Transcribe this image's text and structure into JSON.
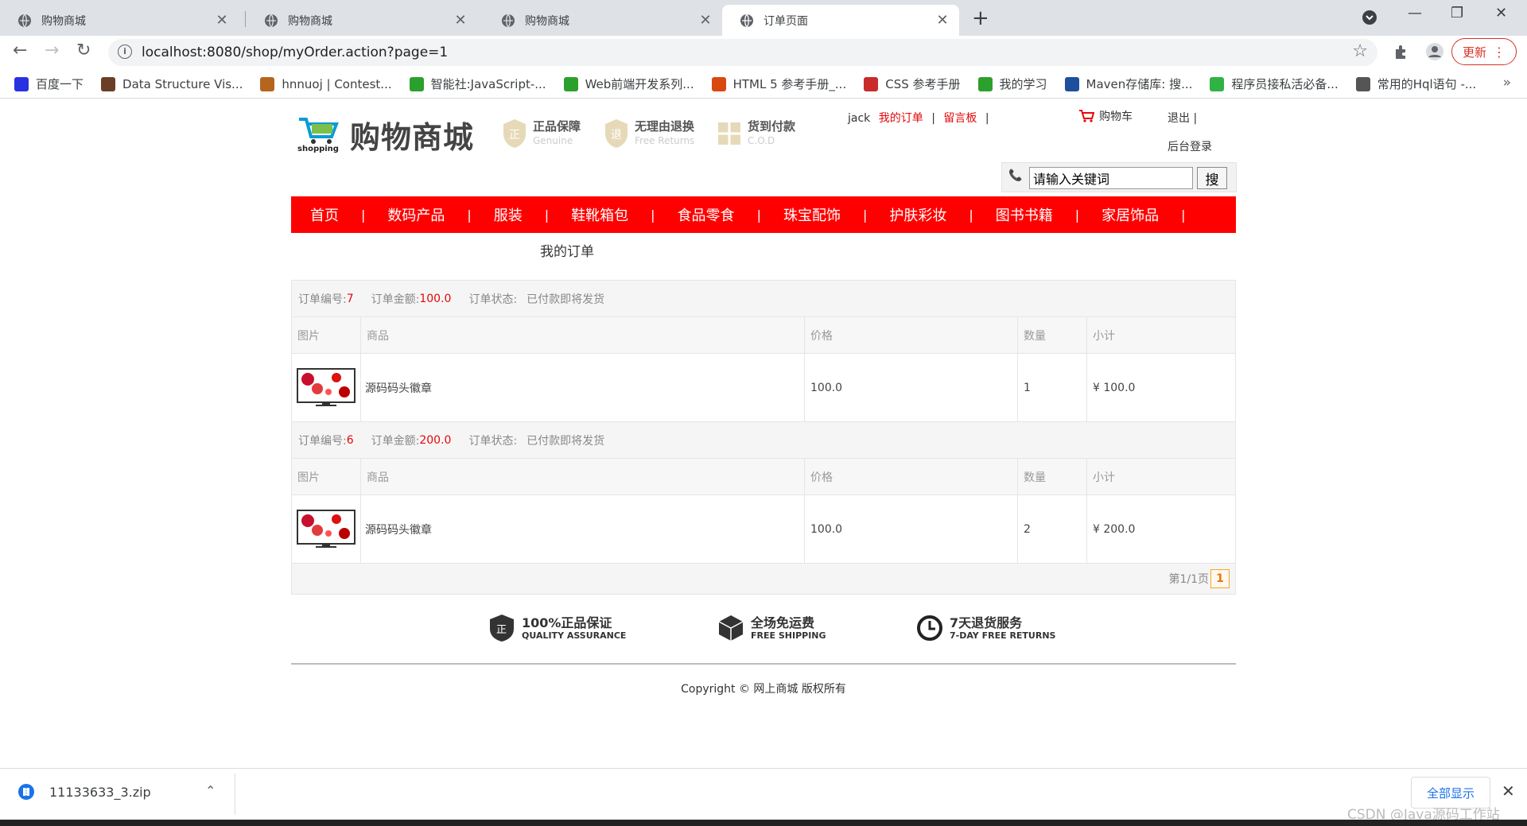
{
  "browser": {
    "tabs": [
      {
        "title": "购物商城",
        "active": false
      },
      {
        "title": "购物商城",
        "active": false
      },
      {
        "title": "购物商城",
        "active": false
      },
      {
        "title": "订单页面",
        "active": true
      }
    ],
    "url": "localhost:8080/shop/myOrder.action?page=1",
    "update_label": "更新",
    "bookmarks": [
      {
        "label": "百度一下",
        "color": "#2932e1"
      },
      {
        "label": "Data Structure Vis...",
        "color": "#6b3e26"
      },
      {
        "label": "hnnuoj | Contest...",
        "color": "#b5651d"
      },
      {
        "label": "智能社:JavaScript-...",
        "color": "#2ca02c"
      },
      {
        "label": "Web前端开发系列...",
        "color": "#2ca02c"
      },
      {
        "label": "HTML 5 参考手册_...",
        "color": "#d9480f"
      },
      {
        "label": "CSS 参考手册",
        "color": "#c92a2a"
      },
      {
        "label": "我的学习",
        "color": "#2ca02c"
      },
      {
        "label": "Maven存储库: 搜...",
        "color": "#1c4f9c"
      },
      {
        "label": "程序员接私活必备...",
        "color": "#2fb344"
      },
      {
        "label": "常用的Hql语句 -...",
        "color": "#555555"
      }
    ],
    "bookmarks_more": "»"
  },
  "site": {
    "logo_name": "购物商城",
    "logo_sub": "shopping",
    "badges": [
      {
        "title": "正品保障",
        "sub": "Genuine"
      },
      {
        "title": "无理由退换",
        "sub": "Free Returns"
      },
      {
        "title": "货到付款",
        "sub": "C.O.D"
      }
    ],
    "user": "jack",
    "my_orders": "我的订单",
    "sep": "|",
    "message_board": "留言板",
    "cart": "购物车",
    "logout": "退出",
    "admin_login": "后台登录",
    "search_value": "请输入关键词",
    "search_button": "搜",
    "menu": [
      "首页",
      "数码产品",
      "服装",
      "鞋靴箱包",
      "食品零食",
      "珠宝配饰",
      "护肤彩妆",
      "图书书籍",
      "家居饰品"
    ],
    "accent_color": "#ff0000"
  },
  "orders_page": {
    "title": "我的订单",
    "labels": {
      "order_no": "订单编号:",
      "order_amount": "订单金额:",
      "order_status": "订单状态:"
    },
    "columns": [
      "图片",
      "商品",
      "价格",
      "数量",
      "小计"
    ],
    "orders": [
      {
        "no": "7",
        "amount": "100.0",
        "status": "已付款即将发货",
        "items": [
          {
            "name": "源码码头徽章",
            "price": "100.0",
            "qty": "1",
            "subtotal": "¥ 100.0"
          }
        ]
      },
      {
        "no": "6",
        "amount": "200.0",
        "status": "已付款即将发货",
        "items": [
          {
            "name": "源码码头徽章",
            "price": "100.0",
            "qty": "2",
            "subtotal": "¥ 200.0"
          }
        ]
      }
    ],
    "pager_text": "第1/1页",
    "current_page": "1"
  },
  "footer": {
    "services": [
      {
        "title": "100%正品保证",
        "sub": "QUALITY ASSURANCE",
        "icon": "shield-icon"
      },
      {
        "title": "全场免运费",
        "sub": "FREE SHIPPING",
        "icon": "box-icon"
      },
      {
        "title": "7天退货服务",
        "sub": "7-DAY FREE RETURNS",
        "icon": "clock-icon"
      }
    ],
    "copyright": "Copyright © 网上商城 版权所有"
  },
  "downloads": {
    "file": "11133633_3.zip",
    "show_all": "全部显示"
  },
  "watermark": "CSDN @Java源码工作站"
}
